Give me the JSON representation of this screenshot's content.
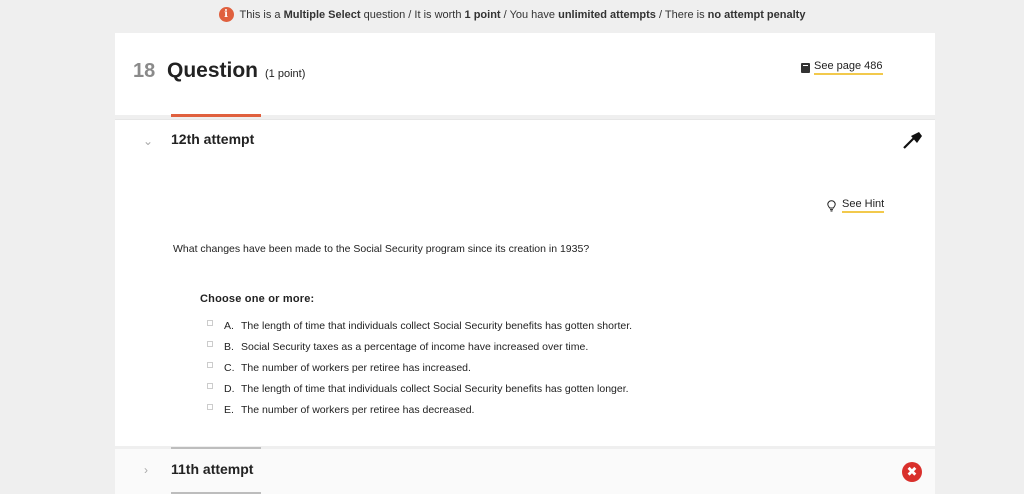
{
  "info_bar": {
    "part1": "This is a ",
    "question_type": "Multiple Select",
    "part2": " question / It is worth ",
    "points": "1 point",
    "part3": " / You have ",
    "attempts": "unlimited attempts",
    "part4": " / There is ",
    "penalty": "no attempt penalty",
    "icon": "info-icon"
  },
  "question": {
    "number": "18",
    "title": "Question",
    "points": "(1 point)",
    "see_page": "See page 486"
  },
  "current_attempt": {
    "title": "12th attempt",
    "hint_label": "See Hint",
    "prompt": "What changes have been made to the Social Security program since its creation in 1935?",
    "choose_label": "Choose one or more:",
    "options": [
      {
        "letter": "A.",
        "text": "The length of time that individuals collect Social Security benefits has gotten shorter."
      },
      {
        "letter": "B.",
        "text": "Social Security taxes as a percentage of income have increased over time."
      },
      {
        "letter": "C.",
        "text": "The number of workers per retiree has increased."
      },
      {
        "letter": "D.",
        "text": "The length of time that individuals collect Social Security benefits has gotten longer."
      },
      {
        "letter": "E.",
        "text": "The number of workers per retiree has decreased."
      }
    ]
  },
  "previous_attempt": {
    "title": "11th attempt",
    "status_icon": "incorrect-icon"
  },
  "colors": {
    "accent": "#e0603e",
    "hint_underline": "#f2c94c",
    "incorrect": "#d9302c"
  }
}
